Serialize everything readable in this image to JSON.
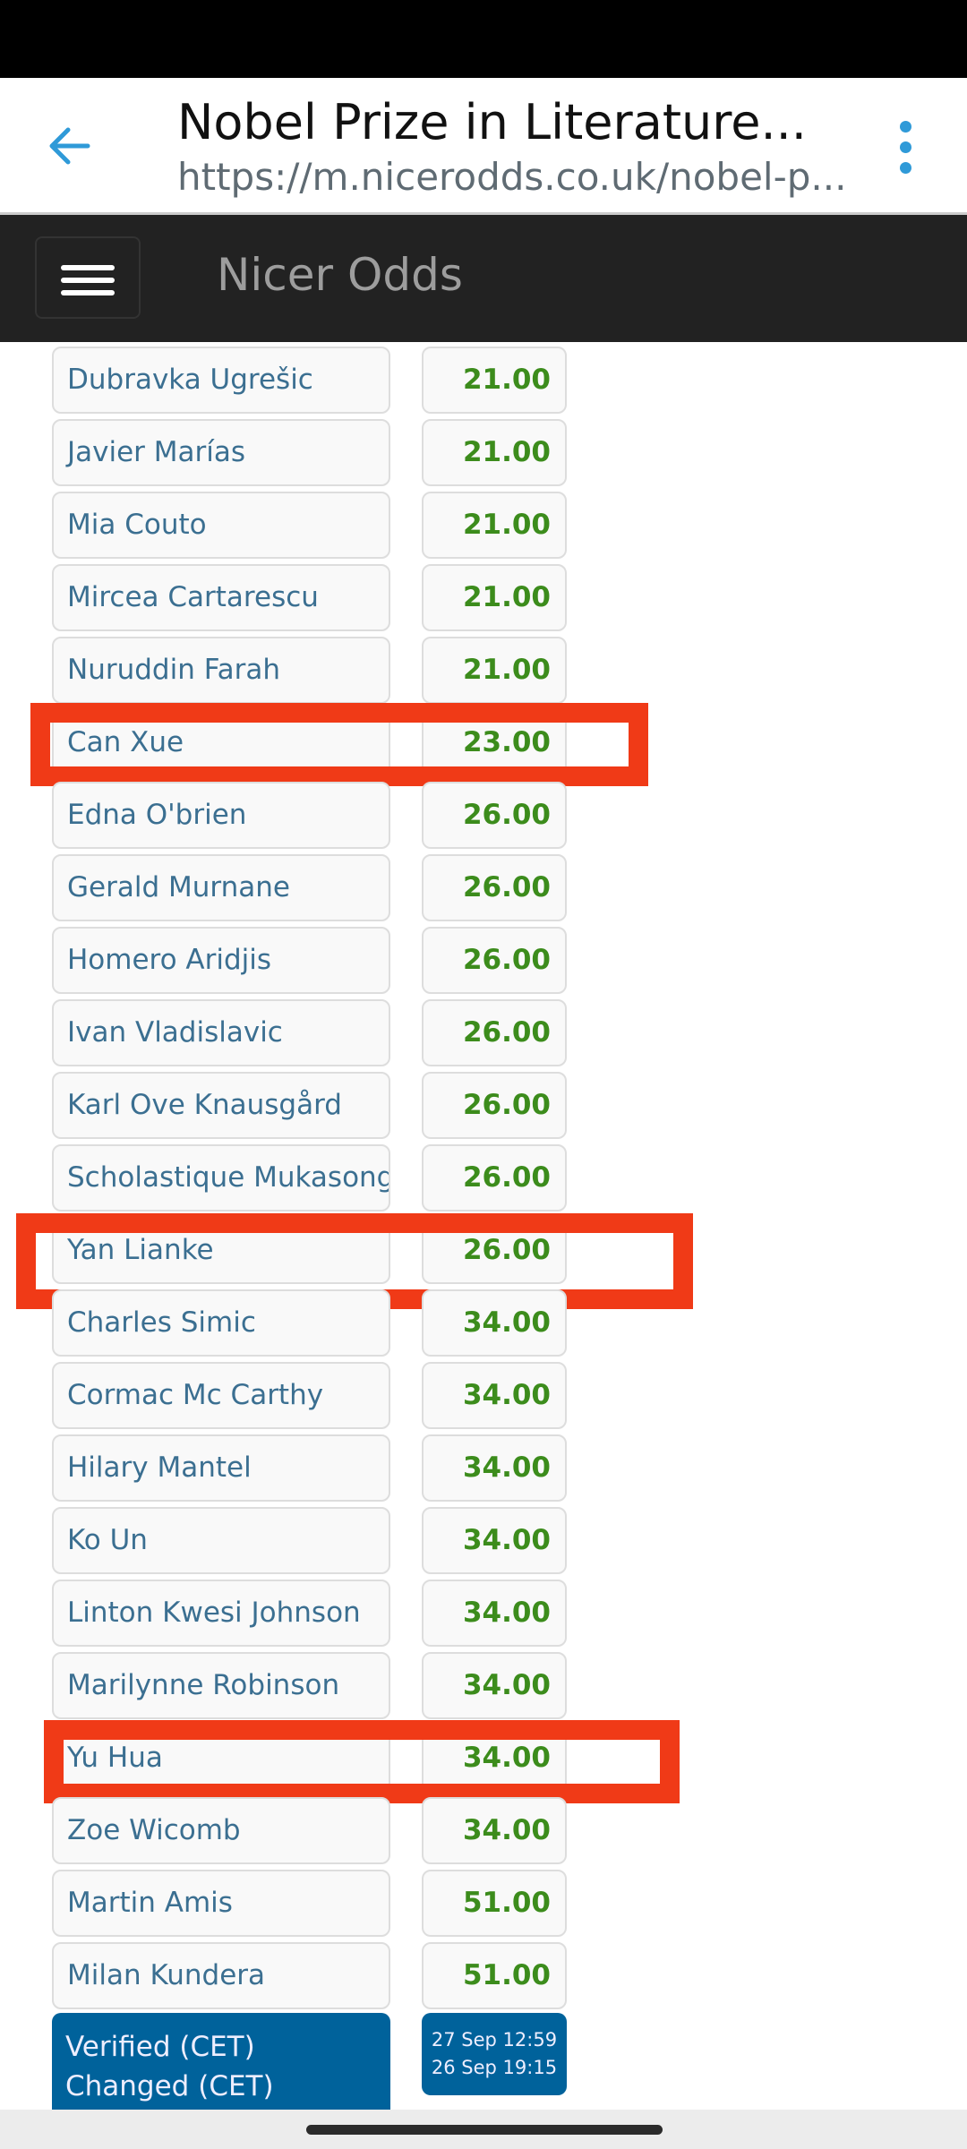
{
  "browser": {
    "title": "Nobel Prize in Literature...",
    "url": "https://m.nicerodds.co.uk/nobel-p...",
    "back_icon": "arrow-left-icon",
    "menu_icon": "more-vert-icon"
  },
  "nav": {
    "brand": "Nicer Odds",
    "menu_icon": "hamburger-icon"
  },
  "rows": [
    {
      "name": "Dubravka Ugrešic",
      "odds": "21.00"
    },
    {
      "name": "Javier Marías",
      "odds": "21.00"
    },
    {
      "name": "Mia Couto",
      "odds": "21.00"
    },
    {
      "name": "Mircea Cartarescu",
      "odds": "21.00"
    },
    {
      "name": "Nuruddin Farah",
      "odds": "21.00"
    },
    {
      "name": "Can Xue",
      "odds": "23.00",
      "highlighted": true
    },
    {
      "name": "Edna O'brien",
      "odds": "26.00"
    },
    {
      "name": "Gerald Murnane",
      "odds": "26.00"
    },
    {
      "name": "Homero Aridjis",
      "odds": "26.00"
    },
    {
      "name": "Ivan Vladislavic",
      "odds": "26.00"
    },
    {
      "name": "Karl Ove Knausgård",
      "odds": "26.00"
    },
    {
      "name": "Scholastique Mukasonga",
      "odds": "26.00"
    },
    {
      "name": "Yan Lianke",
      "odds": "26.00",
      "highlighted": true
    },
    {
      "name": "Charles Simic",
      "odds": "34.00"
    },
    {
      "name": "Cormac Mc Carthy",
      "odds": "34.00"
    },
    {
      "name": "Hilary Mantel",
      "odds": "34.00"
    },
    {
      "name": "Ko Un",
      "odds": "34.00"
    },
    {
      "name": "Linton Kwesi Johnson",
      "odds": "34.00"
    },
    {
      "name": "Marilynne Robinson",
      "odds": "34.00"
    },
    {
      "name": "Yu Hua",
      "odds": "34.00",
      "highlighted": true
    },
    {
      "name": "Zoe Wicomb",
      "odds": "34.00"
    },
    {
      "name": "Martin Amis",
      "odds": "51.00"
    },
    {
      "name": "Milan Kundera",
      "odds": "51.00"
    }
  ],
  "footer": {
    "verified_label": "Verified (CET)",
    "changed_label": "Changed (CET)",
    "verified_time": "27 Sep 12:59",
    "changed_time": "26 Sep 19:15"
  },
  "colors": {
    "name_text": "#3b6f91",
    "odds_text": "#3c8c1c",
    "highlight": "#f03a17",
    "footer_bg": "#00629b",
    "nav_bg": "#222222"
  }
}
